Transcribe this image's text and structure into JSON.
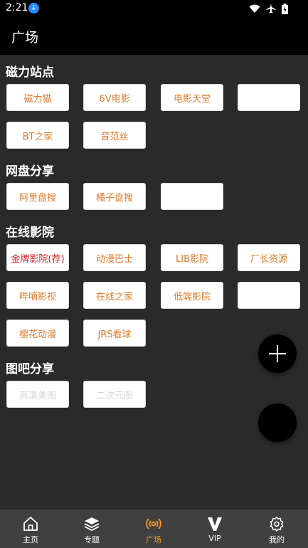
{
  "status_bar": {
    "time": "2:21"
  },
  "app_bar": {
    "title": "广场"
  },
  "sections": [
    {
      "title": "磁力站点",
      "items": [
        "磁力猫",
        "6V电影",
        "电影天堂",
        "",
        "BT之家",
        "音范丝"
      ]
    },
    {
      "title": "网盘分享",
      "items": [
        "阿里盘搜",
        "橘子盘搜",
        ""
      ]
    },
    {
      "title": "在线影院",
      "items": [
        "金牌影院(荐)",
        "动漫巴士",
        "LIB影院",
        "厂长资源",
        "哔嘀影视",
        "在线之家",
        "低端影院",
        "",
        "樱花动漫",
        "JRS看球"
      ]
    },
    {
      "title": "图吧分享",
      "items": [
        "高清美图",
        "二次元图"
      ]
    }
  ],
  "bottom_nav": [
    {
      "label": "主页"
    },
    {
      "label": "专题"
    },
    {
      "label": "广场"
    },
    {
      "label": "VIP"
    },
    {
      "label": "我的"
    }
  ],
  "colors": {
    "accent": "#f39a2a",
    "chip_text": "#e07a2e",
    "chip_highlight": "#d81f26",
    "background": "#2a2a2a"
  }
}
